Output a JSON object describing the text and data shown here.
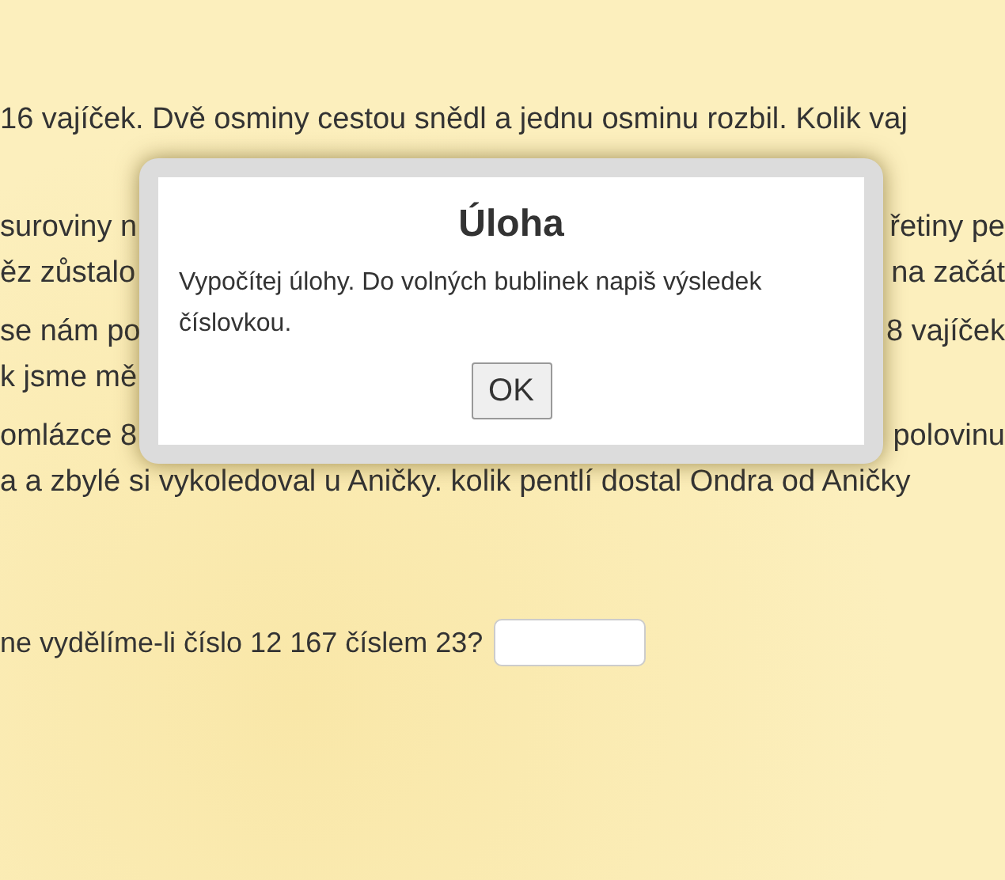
{
  "paragraphs": [
    {
      "lines": [
        {
          "left": "16 vajíček. Dvě osminy cestou snědl a jednu osminu rozbil. Kolik vaj"
        }
      ]
    },
    {
      "lines": [
        {
          "left": "suroviny n",
          "right": "řetiny pe"
        },
        {
          "left": "ěz zůstalo",
          "right": "na začát"
        }
      ]
    },
    {
      "lines": [
        {
          "left": "se nám po",
          "right": "8 vajíček"
        },
        {
          "left": "k jsme mě"
        }
      ]
    },
    {
      "lines": [
        {
          "left": "omlázce 8",
          "right": "polovinu"
        },
        {
          "left": "a a zbylé si vykoledoval u Aničky. kolik pentlí dostal Ondra od Aničky"
        }
      ]
    }
  ],
  "question": {
    "text": "ne vydělíme-li číslo 12 167 číslem 23?"
  },
  "dialog": {
    "title": "Úloha",
    "message": "Vypočítej úlohy. Do volných bublinek napiš výsledek číslovkou.",
    "button": "OK"
  }
}
